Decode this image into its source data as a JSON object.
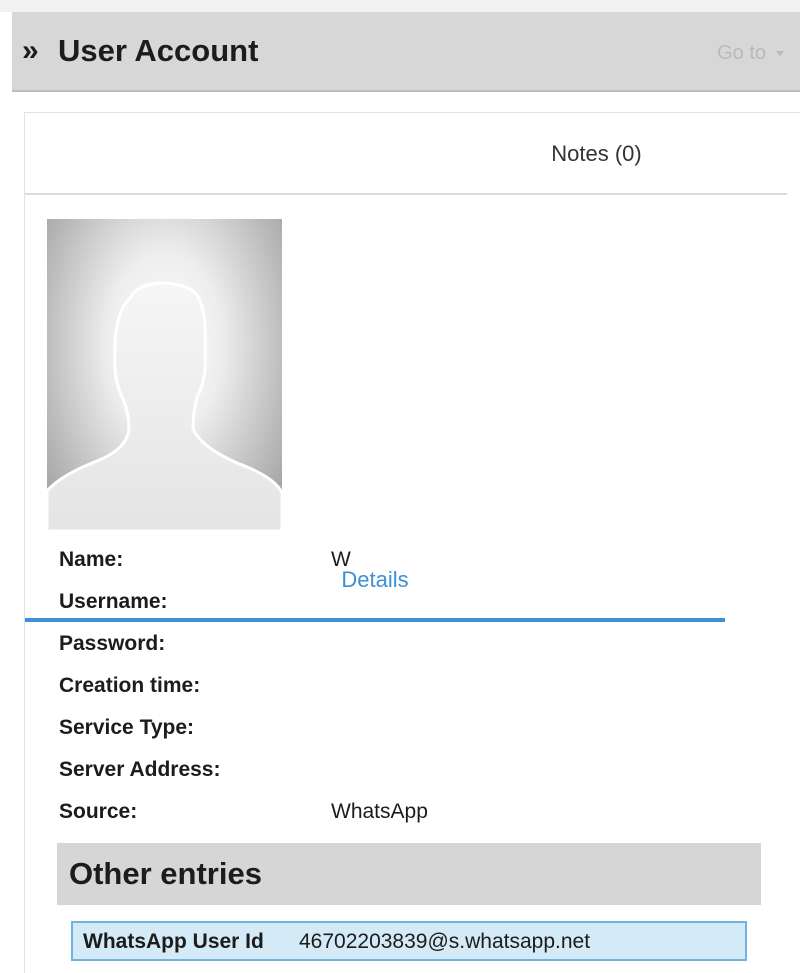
{
  "header": {
    "title": "User Account",
    "chevron": "»",
    "goto_label": "Go to"
  },
  "tabs": [
    {
      "label": "Details",
      "active": true
    },
    {
      "label": "Notes (0)",
      "active": false
    }
  ],
  "avatar": {
    "icon": "default-user-silhouette-icon"
  },
  "fields": [
    {
      "label": "Name:",
      "value": "W"
    },
    {
      "label": "Username:",
      "value": ""
    },
    {
      "label": "Password:",
      "value": ""
    },
    {
      "label": "Creation time:",
      "value": ""
    },
    {
      "label": "Service Type:",
      "value": ""
    },
    {
      "label": "Server Address:",
      "value": ""
    },
    {
      "label": "Source:",
      "value": "WhatsApp"
    }
  ],
  "other_entries": {
    "title": "Other entries",
    "items": [
      {
        "key": "WhatsApp User Id",
        "value": "46702203839@s.whatsapp.net"
      }
    ]
  },
  "colors": {
    "accent": "#3d8fd6",
    "header_bg": "#d7d7d7",
    "entry_bg": "#d4eaf7",
    "entry_border": "#6fb3de"
  }
}
